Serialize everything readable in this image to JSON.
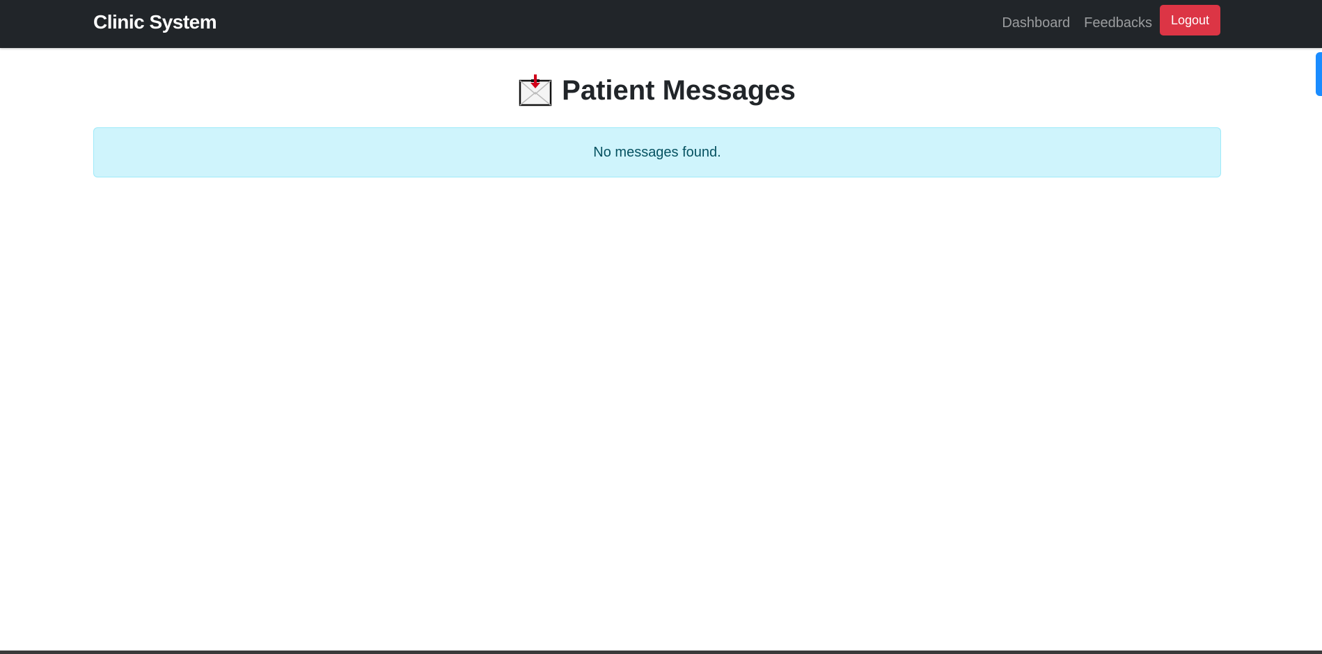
{
  "navbar": {
    "brand": "Clinic System",
    "links": [
      {
        "label": "Dashboard"
      },
      {
        "label": "Feedbacks"
      }
    ],
    "logout_label": "Logout"
  },
  "header": {
    "icon": "inbox-tray-icon",
    "title": "Patient Messages"
  },
  "alert": {
    "text": "No messages found."
  },
  "colors": {
    "navbar_bg": "#212529",
    "logout_bg": "#dc3545",
    "alert_bg": "#cff4fc",
    "alert_border": "#9eeaf9",
    "alert_text": "#055160",
    "edge_handle": "#1a8cff"
  }
}
